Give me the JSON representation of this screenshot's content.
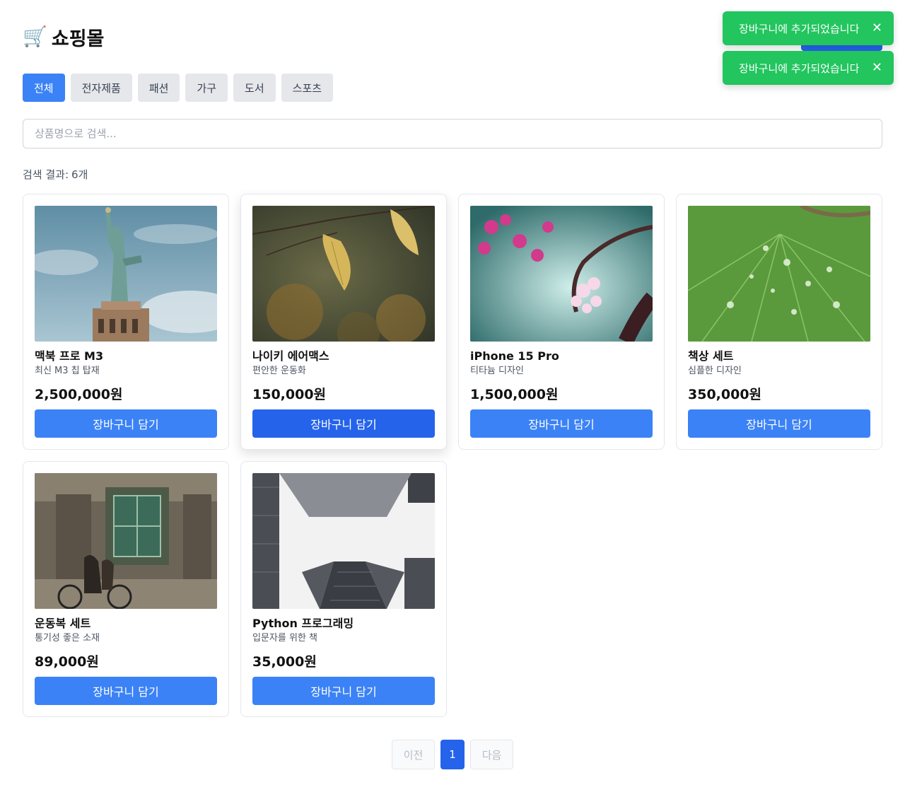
{
  "app": {
    "title": "쇼핑몰"
  },
  "categories": [
    {
      "label": "전체",
      "active": true
    },
    {
      "label": "전자제품",
      "active": false
    },
    {
      "label": "패션",
      "active": false
    },
    {
      "label": "가구",
      "active": false
    },
    {
      "label": "도서",
      "active": false
    },
    {
      "label": "스포츠",
      "active": false
    }
  ],
  "search": {
    "placeholder": "상품명으로 검색...",
    "value": ""
  },
  "results": {
    "label": "검색 결과:",
    "count": "6개"
  },
  "products": [
    {
      "name": "맥북 프로 M3",
      "desc": "최신 M3 칩 탑재",
      "price": "2,500,000원",
      "button": "장바구니 담기",
      "image": "statue-of-liberty-photo"
    },
    {
      "name": "나이키 에어맥스",
      "desc": "편안한 운동화",
      "price": "150,000원",
      "button": "장바구니 담기",
      "image": "autumn-leaves-photo"
    },
    {
      "name": "iPhone 15 Pro",
      "desc": "티타늄 디자인",
      "price": "1,500,000원",
      "button": "장바구니 담기",
      "image": "cherry-blossom-photo"
    },
    {
      "name": "책상 세트",
      "desc": "심플한 디자인",
      "price": "350,000원",
      "button": "장바구니 담기",
      "image": "green-leaf-droplets-photo"
    },
    {
      "name": "운동복 세트",
      "desc": "통기성 좋은 소재",
      "price": "89,000원",
      "button": "장바구니 담기",
      "image": "street-bicycle-photo"
    },
    {
      "name": "Python 프로그래밍",
      "desc": "입문자를 위한 책",
      "price": "35,000원",
      "button": "장바구니 담기",
      "image": "skyscrapers-photo"
    }
  ],
  "pagination": {
    "prev": "이전",
    "current": "1",
    "next": "다음"
  },
  "toasts": [
    {
      "message": "장바구니에 추가되었습니다",
      "close": "✕"
    },
    {
      "message": "장바구니에 추가되었습니다",
      "close": "✕"
    }
  ],
  "colors": {
    "primary": "#3b82f6",
    "primary_dark": "#2563eb",
    "toast": "#22c55e"
  }
}
